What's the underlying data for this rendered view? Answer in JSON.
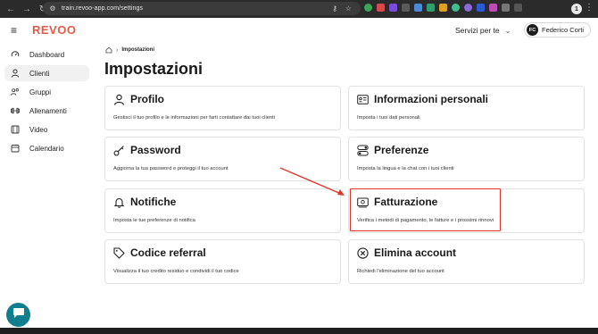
{
  "browser": {
    "url": "train.revoo-app.com/settings",
    "profile_initial": "1"
  },
  "header": {
    "logo": "REVOO",
    "services_label": "Servizi per te",
    "user_initials": "FC",
    "user_name": "Federico Corti"
  },
  "sidebar": {
    "items": [
      {
        "label": "Dashboard",
        "icon": "speedometer-icon",
        "active": false
      },
      {
        "label": "Clienti",
        "icon": "user-icon",
        "active": true
      },
      {
        "label": "Gruppi",
        "icon": "group-icon",
        "active": false
      },
      {
        "label": "Allenamenti",
        "icon": "dumbbell-icon",
        "active": false
      },
      {
        "label": "Video",
        "icon": "film-icon",
        "active": false
      },
      {
        "label": "Calendario",
        "icon": "calendar-icon",
        "active": false
      }
    ]
  },
  "breadcrumb": {
    "current": "Impostazioni"
  },
  "page": {
    "title": "Impostazioni"
  },
  "cards": [
    {
      "title": "Profilo",
      "description": "Gestisci il tuo profilo e le informazioni per farti contattare dai tuoi clienti",
      "icon": "user-icon"
    },
    {
      "title": "Informazioni personali",
      "description": "Imposta i tuoi dati personali",
      "icon": "id-card-icon"
    },
    {
      "title": "Password",
      "description": "Aggiorna la tua password e proteggi il tuo account",
      "icon": "key-icon"
    },
    {
      "title": "Preferenze",
      "description": "Imposta la lingua e la chat con i tuoi clienti",
      "icon": "toggles-icon"
    },
    {
      "title": "Notifiche",
      "description": "Imposta le tue preferenze di notifica",
      "icon": "bell-icon"
    },
    {
      "title": "Fatturazione",
      "description": "Verifica i metodi di pagamento, le fatture e i prossimi rinnovi",
      "icon": "billing-icon"
    },
    {
      "title": "Codice referral",
      "description": "Visualizza il tuo credito residuo e condividi il tuo codice",
      "icon": "tag-icon"
    },
    {
      "title": "Elimina account",
      "description": "Richiedi l'eliminazione del tuo account",
      "icon": "x-circle-icon"
    }
  ],
  "colors": {
    "brand": "#e25a47",
    "annotation": "#e0342a",
    "chat_button": "#0f7f8f"
  }
}
